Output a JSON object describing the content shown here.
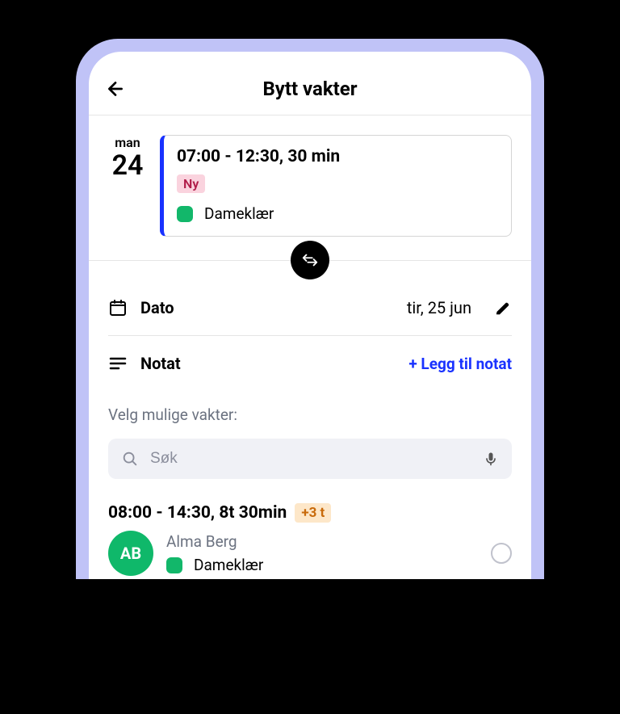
{
  "header": {
    "title": "Bytt vakter"
  },
  "currentShift": {
    "dayLabel": "man",
    "dayNumber": "24",
    "time": "07:00 - 12:30, 30 min",
    "statusBadge": "Ny",
    "category": "Dameklær",
    "accentColor": "#1932ff",
    "categoryColor": "#12b76a"
  },
  "dateRow": {
    "label": "Dato",
    "value": "tir, 25 jun"
  },
  "noteRow": {
    "label": "Notat",
    "addLink": "+ Legg til notat"
  },
  "possibleSection": {
    "label": "Velg mulige vakter:",
    "searchPlaceholder": "Søk"
  },
  "shifts": [
    {
      "time": "08:00 - 14:30, 8t 30min",
      "extraBadge": "+3 t",
      "personName": "Alma Berg",
      "avatarInitials": "AB",
      "category": "Dameklær",
      "avatarColor": "#0fb86a",
      "categoryColor": "#12b76a"
    }
  ]
}
